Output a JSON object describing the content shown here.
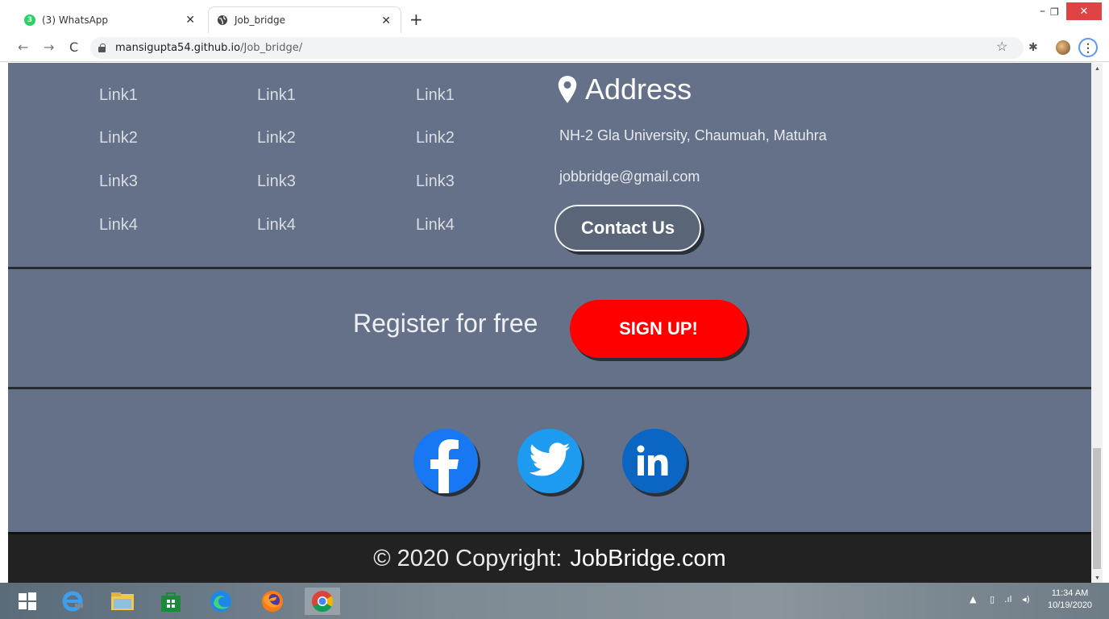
{
  "browser": {
    "tabs": [
      {
        "label": "(3) WhatsApp",
        "badge": "3"
      },
      {
        "label": "Job_bridge"
      }
    ],
    "url_host": "mansigupta54.github.io",
    "url_path": "/Job_bridge/"
  },
  "page": {
    "link_columns": [
      [
        "Link1",
        "Link2",
        "Link3",
        "Link4"
      ],
      [
        "Link1",
        "Link2",
        "Link3",
        "Link4"
      ],
      [
        "Link1",
        "Link2",
        "Link3",
        "Link4"
      ]
    ],
    "address": {
      "title": "Address",
      "line1": "NH-2 Gla University, Chaumuah, Matuhra",
      "line2": "jobbridge@gmail.com",
      "contact_label": "Contact Us"
    },
    "register": {
      "text": "Register for free",
      "button": "SIGN UP!"
    },
    "social": [
      {
        "name": "facebook-icon",
        "color": "#1877f2"
      },
      {
        "name": "twitter-icon",
        "color": "#1d9bf0"
      },
      {
        "name": "linkedin-icon",
        "color": "#0a66c2"
      }
    ],
    "footer": {
      "copyright": "© 2020 Copyright:",
      "brand": "JobBridge.com"
    },
    "colors": {
      "page_bg": "#647188",
      "signup": "#ff0000",
      "footer_bg": "#222222"
    }
  },
  "taskbar": {
    "time": "11:34 AM",
    "date": "10/19/2020"
  }
}
